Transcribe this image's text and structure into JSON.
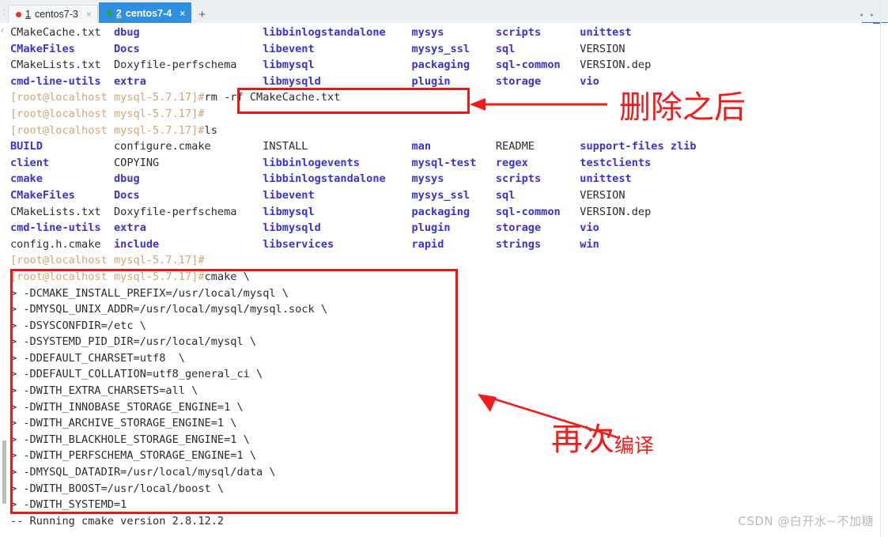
{
  "window": {
    "tabbar": {
      "tabs": [
        {
          "index": "1",
          "label": "centos7-3",
          "dot_color": "#e8342a",
          "active": false,
          "close": "×"
        },
        {
          "index": "2",
          "label": "centos7-4",
          "dot_color": "#1faa44",
          "active": true,
          "close": "×"
        }
      ],
      "new_tab_label": "+",
      "rail_glyph": ":",
      "scroll_left_glyph": "◂",
      "scroll_right_glyph": "▸"
    }
  },
  "terminal": {
    "prompt": "[root@localhost mysql-5.7.17]#",
    "continuation": "> ",
    "ls_block_1": {
      "columns_note": "first ls output (partially scrolled, top 4 rows visible)",
      "rows": [
        [
          {
            "t": "CMakeCache.txt",
            "k": "fil"
          },
          {
            "t": "dbug",
            "k": "dir"
          },
          {
            "t": "libbinlogstandalone",
            "k": "dir"
          },
          {
            "t": "mysys",
            "k": "dir"
          },
          {
            "t": "scripts",
            "k": "dir"
          },
          {
            "t": "unittest",
            "k": "dir"
          }
        ],
        [
          {
            "t": "CMakeFiles",
            "k": "dir"
          },
          {
            "t": "Docs",
            "k": "dir"
          },
          {
            "t": "libevent",
            "k": "dir"
          },
          {
            "t": "mysys_ssl",
            "k": "dir"
          },
          {
            "t": "sql",
            "k": "dir"
          },
          {
            "t": "VERSION",
            "k": "fil"
          }
        ],
        [
          {
            "t": "CMakeLists.txt",
            "k": "fil"
          },
          {
            "t": "Doxyfile-perfschema",
            "k": "fil"
          },
          {
            "t": "libmysql",
            "k": "dir"
          },
          {
            "t": "packaging",
            "k": "dir"
          },
          {
            "t": "sql-common",
            "k": "dir"
          },
          {
            "t": "VERSION.dep",
            "k": "fil"
          }
        ],
        [
          {
            "t": "cmd-line-utils",
            "k": "dir"
          },
          {
            "t": "extra",
            "k": "dir"
          },
          {
            "t": "libmysqld",
            "k": "dir"
          },
          {
            "t": "plugin",
            "k": "dir"
          },
          {
            "t": "storage",
            "k": "dir"
          },
          {
            "t": "vio",
            "k": "dir"
          }
        ]
      ]
    },
    "command_rm": "rm -rf CMakeCache.txt",
    "command_empty": "",
    "command_ls": "ls",
    "ls_block_2": {
      "columns_note": "second ls output after CMakeCache.txt was removed",
      "rows": [
        [
          {
            "t": "BUILD",
            "k": "dir"
          },
          {
            "t": "configure.cmake",
            "k": "fil"
          },
          {
            "t": "INSTALL",
            "k": "fil"
          },
          {
            "t": "man",
            "k": "dir"
          },
          {
            "t": "README",
            "k": "fil"
          },
          {
            "t": "support-files",
            "k": "dir"
          },
          {
            "t": "zlib",
            "k": "dir"
          }
        ],
        [
          {
            "t": "client",
            "k": "dir"
          },
          {
            "t": "COPYING",
            "k": "fil"
          },
          {
            "t": "libbinlogevents",
            "k": "dir"
          },
          {
            "t": "mysql-test",
            "k": "dir"
          },
          {
            "t": "regex",
            "k": "dir"
          },
          {
            "t": "testclients",
            "k": "dir"
          }
        ],
        [
          {
            "t": "cmake",
            "k": "dir"
          },
          {
            "t": "dbug",
            "k": "dir"
          },
          {
            "t": "libbinlogstandalone",
            "k": "dir"
          },
          {
            "t": "mysys",
            "k": "dir"
          },
          {
            "t": "scripts",
            "k": "dir"
          },
          {
            "t": "unittest",
            "k": "dir"
          }
        ],
        [
          {
            "t": "CMakeFiles",
            "k": "dir"
          },
          {
            "t": "Docs",
            "k": "dir"
          },
          {
            "t": "libevent",
            "k": "dir"
          },
          {
            "t": "mysys_ssl",
            "k": "dir"
          },
          {
            "t": "sql",
            "k": "dir"
          },
          {
            "t": "VERSION",
            "k": "fil"
          }
        ],
        [
          {
            "t": "CMakeLists.txt",
            "k": "fil"
          },
          {
            "t": "Doxyfile-perfschema",
            "k": "fil"
          },
          {
            "t": "libmysql",
            "k": "dir"
          },
          {
            "t": "packaging",
            "k": "dir"
          },
          {
            "t": "sql-common",
            "k": "dir"
          },
          {
            "t": "VERSION.dep",
            "k": "fil"
          }
        ],
        [
          {
            "t": "cmd-line-utils",
            "k": "dir"
          },
          {
            "t": "extra",
            "k": "dir"
          },
          {
            "t": "libmysqld",
            "k": "dir"
          },
          {
            "t": "plugin",
            "k": "dir"
          },
          {
            "t": "storage",
            "k": "dir"
          },
          {
            "t": "vio",
            "k": "dir"
          }
        ],
        [
          {
            "t": "config.h.cmake",
            "k": "fil"
          },
          {
            "t": "include",
            "k": "dir"
          },
          {
            "t": "libservices",
            "k": "dir"
          },
          {
            "t": "rapid",
            "k": "dir"
          },
          {
            "t": "strings",
            "k": "dir"
          },
          {
            "t": "win",
            "k": "dir"
          }
        ]
      ]
    },
    "cmake_command": {
      "first_line": "cmake \\",
      "continuation_lines": [
        "-DCMAKE_INSTALL_PREFIX=/usr/local/mysql \\",
        "-DMYSQL_UNIX_ADDR=/usr/local/mysql/mysql.sock \\",
        "-DSYSCONFDIR=/etc \\",
        "-DSYSTEMD_PID_DIR=/usr/local/mysql \\",
        "-DDEFAULT_CHARSET=utf8  \\",
        "-DDEFAULT_COLLATION=utf8_general_ci \\",
        "-DWITH_EXTRA_CHARSETS=all \\",
        "-DWITH_INNOBASE_STORAGE_ENGINE=1 \\",
        "-DWITH_ARCHIVE_STORAGE_ENGINE=1 \\",
        "-DWITH_BLACKHOLE_STORAGE_ENGINE=1 \\",
        "-DWITH_PERFSCHEMA_STORAGE_ENGINE=1 \\",
        "-DMYSQL_DATADIR=/usr/local/mysql/data \\",
        "-DWITH_BOOST=/usr/local/boost \\",
        "-DWITH_SYSTEMD=1"
      ]
    },
    "output_tail": "-- Running cmake version 2.8.12.2"
  },
  "annotations": {
    "color": "#f51a1a",
    "box_rm_command": "highlights the rm -rf CMakeCache.txt line",
    "box_cmake_command": "highlights the whole cmake invocation",
    "label_after_delete": "删除之后",
    "label_recompile_main": "再次",
    "label_recompile_sub": "编译"
  },
  "watermark": "CSDN @白开水~不加糖",
  "colors": {
    "directory": "#3a31d8",
    "file": "#2b2b2b",
    "prompt": "#cfa678",
    "annotation_red": "#f51a1a",
    "tab_active_bg": "#2f8fe0"
  }
}
